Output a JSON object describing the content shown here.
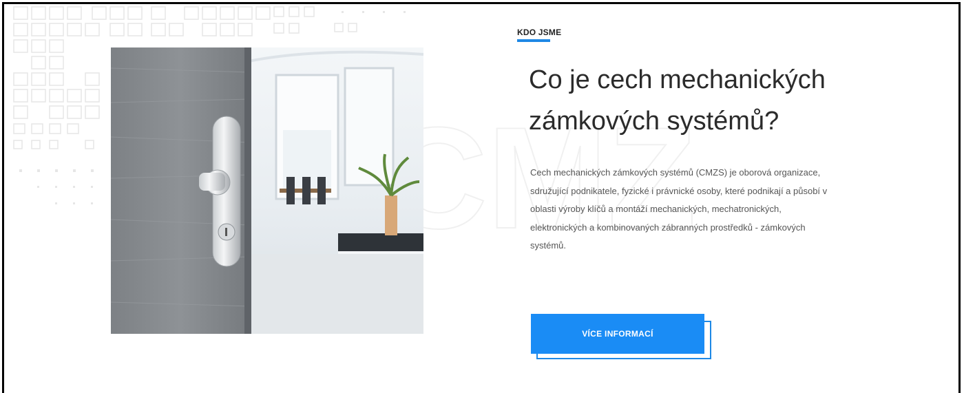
{
  "section": {
    "eyebrow": "KDO JSME",
    "headline_line1": "Co je cech mechanických",
    "headline_line2": "zámkových systémů?",
    "body": "Cech mechanických zámkových systémů (CMZS) je oborová organizace, sdružující podnikatele, fyzické i právnické osoby, které podnikají a působí v oblasti výroby klíčů a montáží mechanických, mechatronických, elektronických a kombinovaných zábranných prostředků - zámkových systémů.",
    "cta_label": "VÍCE INFORMACÍ",
    "watermark": "CMZS"
  },
  "colors": {
    "accent": "#1e88e5",
    "button": "#1a8cf5",
    "heading": "#2b2b2b",
    "body": "#555555"
  },
  "icons": {
    "image": "door-handle-photo"
  }
}
